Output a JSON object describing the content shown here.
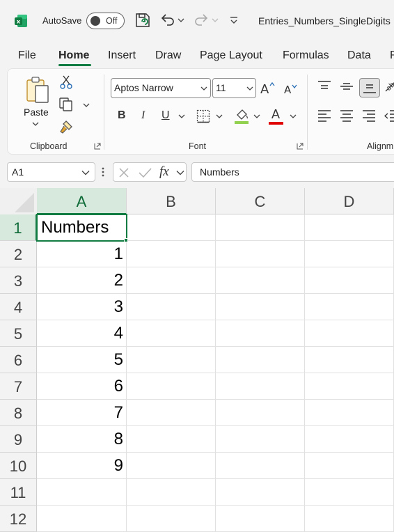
{
  "titlebar": {
    "app_icon": "excel-logo-icon",
    "autosave_label": "AutoSave",
    "autosave_state": "Off",
    "document_title": "Entries_Numbers_SingleDigits"
  },
  "menu": {
    "tabs": [
      "File",
      "Home",
      "Insert",
      "Draw",
      "Page Layout",
      "Formulas",
      "Data",
      "R"
    ],
    "active_tab": "Home"
  },
  "ribbon": {
    "clipboard": {
      "paste_label": "Paste",
      "group_label": "Clipboard"
    },
    "font": {
      "font_name": "Aptos Narrow",
      "font_size": "11",
      "bold": "B",
      "italic": "I",
      "underline": "U",
      "font_color_glyph": "A",
      "group_label": "Font",
      "fill_color": "#92d050",
      "font_color": "#e00000"
    },
    "alignment": {
      "group_label": "Alignm"
    }
  },
  "formula_bar": {
    "name_box": "A1",
    "fx_label": "fx",
    "content": "Numbers"
  },
  "sheet": {
    "columns": [
      "A",
      "B",
      "C",
      "D"
    ],
    "rows": [
      "1",
      "2",
      "3",
      "4",
      "5",
      "6",
      "7",
      "8",
      "9",
      "10",
      "11",
      "12"
    ],
    "cells": {
      "A1": "Numbers",
      "A2": "1",
      "A3": "2",
      "A4": "3",
      "A5": "4",
      "A6": "5",
      "A7": "6",
      "A8": "7",
      "A9": "8",
      "A10": "9"
    },
    "selected_cell": "A1",
    "accent_color": "#107c41"
  }
}
